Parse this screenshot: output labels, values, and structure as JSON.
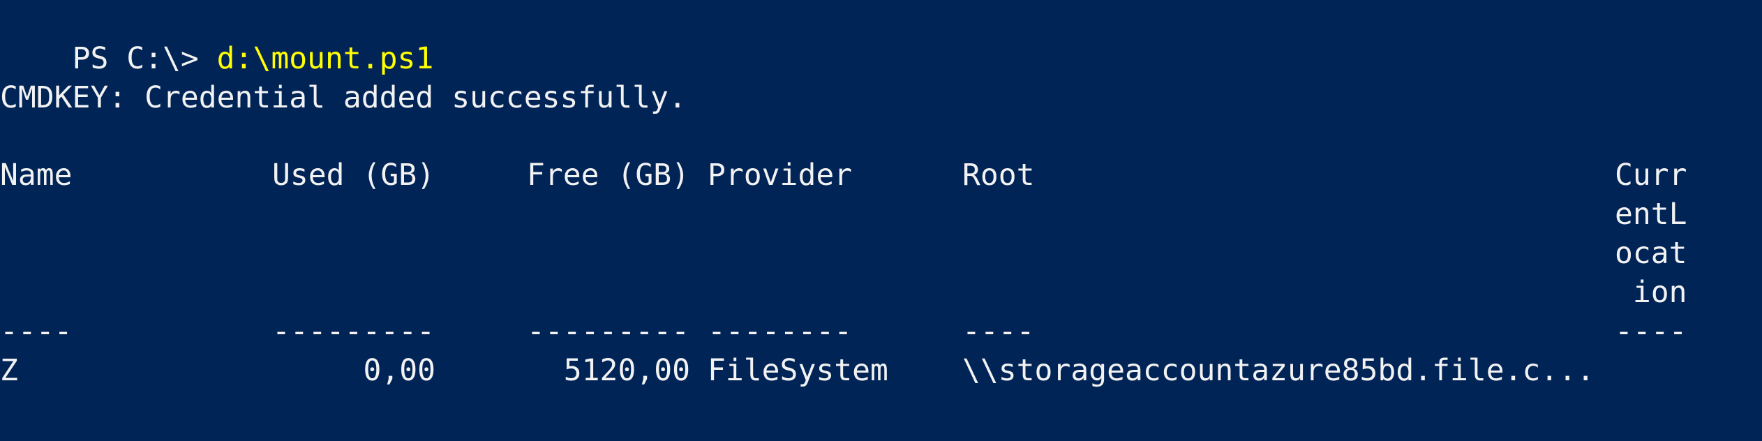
{
  "console": {
    "prompt": "PS C:\\> ",
    "command": "d:\\mount.ps1",
    "message": "CMDKEY: Credential added successfully."
  },
  "table": {
    "headers": {
      "name": "Name",
      "used": "Used (GB)",
      "free": "Free (GB)",
      "provider": "Provider",
      "root": "Root",
      "current_location": [
        "Curr",
        "entL",
        "ocat",
        " ion"
      ]
    },
    "separators": {
      "name": "----",
      "used": "---------",
      "free": "---------",
      "provider": "--------",
      "root": "----",
      "current_location": "----"
    },
    "rows": [
      {
        "name": "Z",
        "used": "0,00",
        "free": "5120,00",
        "provider": "FileSystem",
        "root": "\\\\storageaccountazure85bd.file.c...",
        "current_location": ""
      }
    ]
  }
}
